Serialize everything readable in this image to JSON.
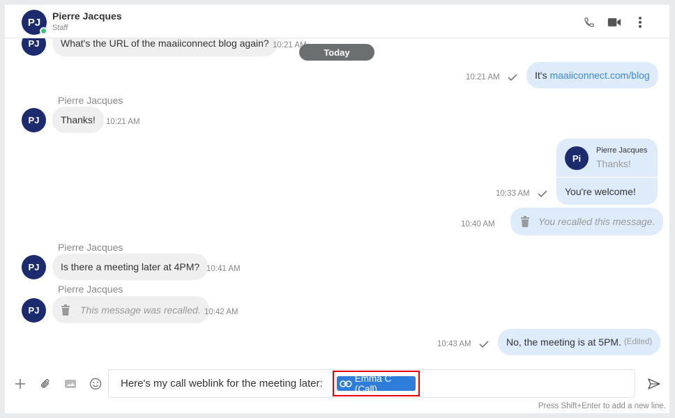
{
  "header": {
    "avatar_initials": "PJ",
    "name": "Pierre Jacques",
    "role": "Staff",
    "presence_color": "#3cc27a"
  },
  "today_label": "Today",
  "messages": {
    "m1": {
      "avatar": "PJ",
      "text": "What's the URL of the maaiiconnect blog again?",
      "time": "10:21 AM"
    },
    "m2": {
      "text_prefix": "It's ",
      "link": "maaiiconnect.com/blog",
      "time": "10:21 AM"
    },
    "m3": {
      "sender": "Pierre Jacques",
      "avatar": "PJ",
      "text": "Thanks!",
      "time": "10:21 AM"
    },
    "m4": {
      "quote_avatar": "Pi",
      "quote_name": "Pierre Jacques",
      "quote_text": "Thanks!",
      "text": "You're welcome!",
      "time": "10:33 AM"
    },
    "m5": {
      "text": "You recalled this message.",
      "time": "10:40 AM"
    },
    "m6": {
      "sender": "Pierre Jacques",
      "avatar": "PJ",
      "text": "Is there a meeting later at 4PM?",
      "time": "10:41 AM"
    },
    "m7": {
      "sender": "Pierre Jacques",
      "avatar": "PJ",
      "text": "This message was recalled.",
      "time": "10:42 AM"
    },
    "m8": {
      "text": "No, the meeting is at 5PM.",
      "edited": "(Edited)",
      "time": "10:43 AM"
    }
  },
  "composer": {
    "text": "Here's my call weblink for the meeting later: ",
    "chip_label": "Emma C (Call)",
    "hint": "Press Shift+Enter to add a new line."
  },
  "icons": {
    "add": "plus-icon",
    "attach": "paperclip-icon",
    "gif": "gif-icon",
    "emoji": "smiley-icon",
    "send": "send-icon",
    "call": "phone-icon",
    "video": "video-icon",
    "more": "more-vertical-icon",
    "recall": "trash-icon",
    "read": "checkmark-icon"
  },
  "colors": {
    "brand": "#1c2a6e",
    "outgoing_bubble": "#ddebfb",
    "incoming_bubble": "#efefef",
    "link": "#3d87dc",
    "chip": "#2f7ddb",
    "highlight": "#e00000"
  }
}
